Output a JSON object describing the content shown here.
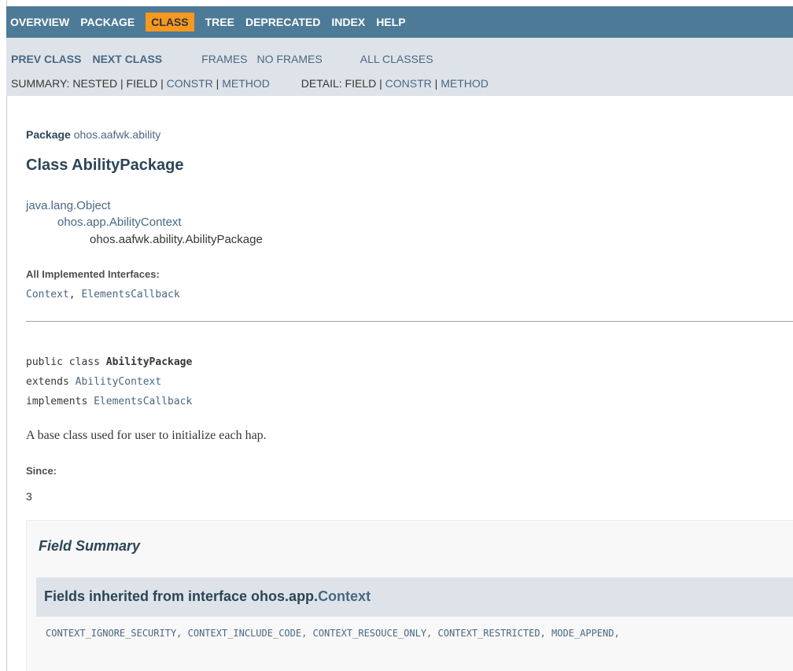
{
  "topnav": {
    "items": [
      "OVERVIEW",
      "PACKAGE",
      "CLASS",
      "TREE",
      "DEPRECATED",
      "INDEX",
      "HELP"
    ],
    "active": "CLASS"
  },
  "subnav": {
    "prev_class": "PREV CLASS",
    "next_class": "NEXT CLASS",
    "frames": "FRAMES",
    "no_frames": "NO FRAMES",
    "all_classes": "ALL CLASSES",
    "summary_label": "SUMMARY:",
    "summary_nested": "NESTED",
    "summary_field": "FIELD",
    "summary_constr": "CONSTR",
    "summary_method": "METHOD",
    "detail_label": "DETAIL:",
    "detail_field": "FIELD",
    "detail_constr": "CONSTR",
    "detail_method": "METHOD",
    "sep": "|"
  },
  "header": {
    "package_label": "Package",
    "package_name": "ohos.aafwk.ability",
    "class_title": "Class AbilityPackage"
  },
  "inheritance": [
    "java.lang.Object",
    "ohos.app.AbilityContext",
    "ohos.aafwk.ability.AbilityPackage"
  ],
  "implemented": {
    "label": "All Implemented Interfaces:",
    "items": [
      "Context",
      "ElementsCallback"
    ],
    "comma": ","
  },
  "signature": {
    "line1_prefix": "public class ",
    "line1_name": "AbilityPackage",
    "line2_prefix": "extends ",
    "line2_link": "AbilityContext",
    "line3_prefix": "implements ",
    "line3_link": "ElementsCallback"
  },
  "description": "A base class used for user to initialize each hap.",
  "since": {
    "label": "Since:",
    "value": "3"
  },
  "field_summary": {
    "title": "Field Summary",
    "inherited_prefix": "Fields inherited from interface ohos.app.",
    "inherited_link": "Context",
    "fields": "CONTEXT_IGNORE_SECURITY, CONTEXT_INCLUDE_CODE, CONTEXT_RESOUCE_ONLY, CONTEXT_RESTRICTED, MODE_APPEND,"
  }
}
